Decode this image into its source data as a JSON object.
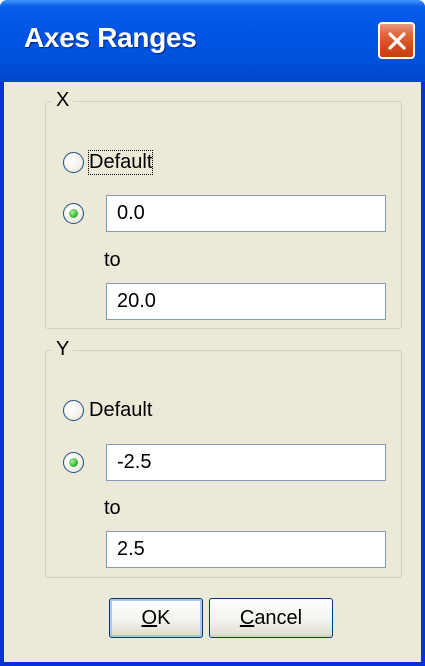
{
  "window": {
    "title": "Axes Ranges",
    "close_icon": "close-icon"
  },
  "x_group": {
    "legend": "X",
    "default_label": "Default",
    "selected": "custom",
    "from_value": "0.0",
    "to_label": "to",
    "to_value": "20.0"
  },
  "y_group": {
    "legend": "Y",
    "default_label": "Default",
    "selected": "custom",
    "from_value": "-2.5",
    "to_label": "to",
    "to_value": "2.5"
  },
  "buttons": {
    "ok_mnemonic": "O",
    "ok_rest": "K",
    "cancel_mnemonic": "C",
    "cancel_rest": "ancel"
  },
  "colors": {
    "titlebar": "#0055e5",
    "client_bg": "#ece9d8",
    "close_button": "#d24a1d",
    "radio_selected": "#3fbd3c"
  }
}
